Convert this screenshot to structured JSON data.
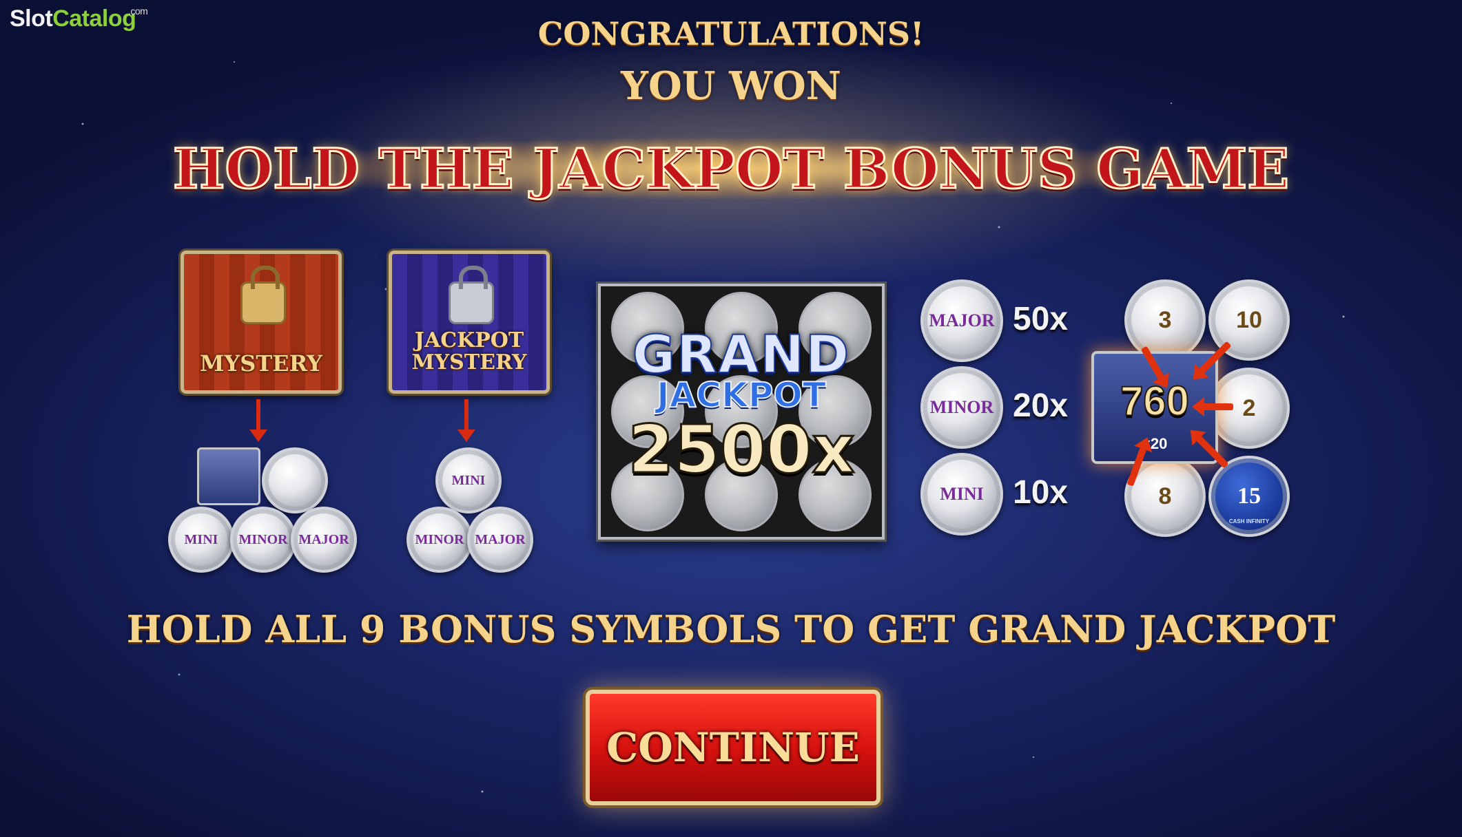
{
  "watermark": {
    "brand_part1": "Slot",
    "brand_part2": "Catalog",
    "brand_suffix": ".com"
  },
  "header": {
    "congrats": "CONGRATULATIONS!",
    "you_won": "YOU WON",
    "bonus_title": "HOLD THE JACKPOT BONUS GAME"
  },
  "mystery": {
    "label": "MYSTERY",
    "coins": [
      "MINI",
      "MINOR",
      "MAJOR"
    ]
  },
  "jackpot_mystery": {
    "label_line1": "JACKPOT",
    "label_line2": "MYSTERY",
    "coins": [
      "MINI",
      "MINOR",
      "MAJOR"
    ]
  },
  "grand_jackpot": {
    "word1": "GRAND",
    "word2": "JACKPOT",
    "value": "2500x"
  },
  "paytable": [
    {
      "coin": "MAJOR",
      "mult": "50x"
    },
    {
      "coin": "MINOR",
      "mult": "20x"
    },
    {
      "coin": "MINI",
      "mult": "10x"
    }
  ],
  "collector": {
    "value": "760",
    "mult": "x20",
    "coins": [
      "3",
      "10",
      "2",
      "8",
      "15"
    ],
    "blue_coin_subtext": "CASH INFINITY"
  },
  "instruction": "HOLD ALL 9 BONUS SYMBOLS TO GET GRAND JACKPOT",
  "continue_label": "CONTINUE",
  "colors": {
    "gold": "#f6d38a",
    "title_red": "#c3161b",
    "button_red": "#d8120f",
    "brand_green": "#8dd13a"
  }
}
